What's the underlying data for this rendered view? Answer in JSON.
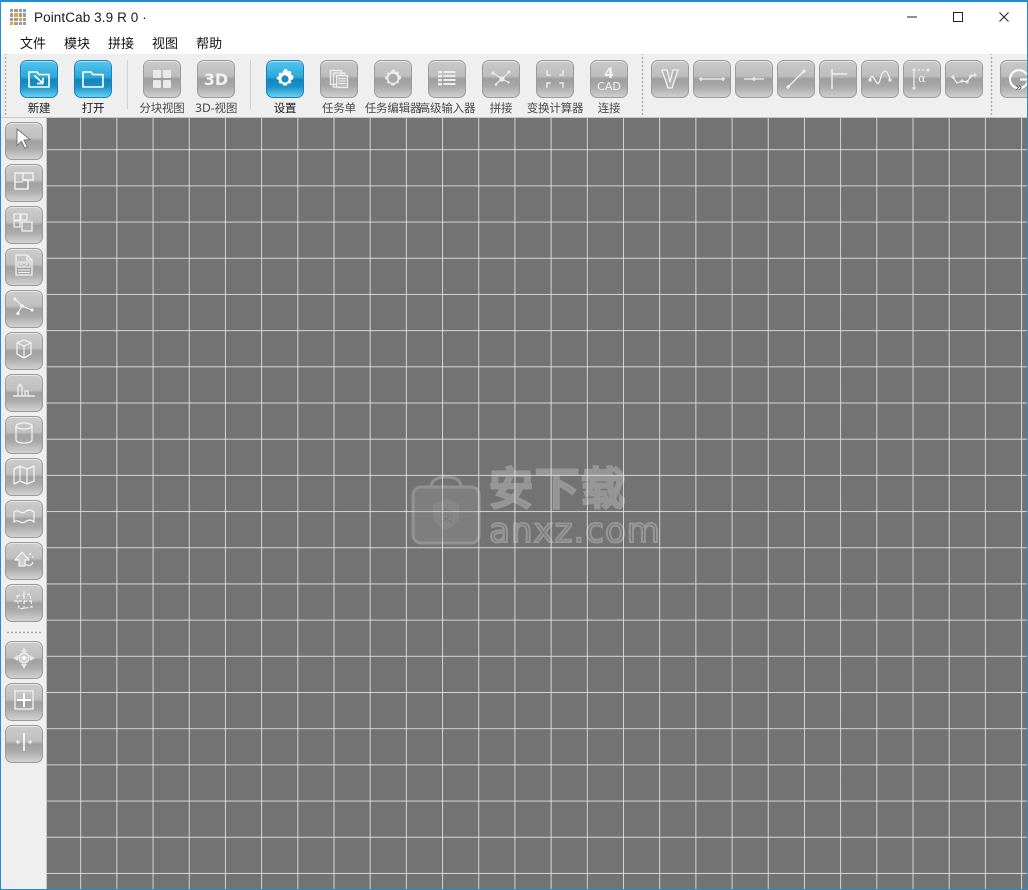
{
  "window": {
    "title": "PointCab 3.9 R 0 ·",
    "app_icon": "dotmatrix-logo-icon",
    "controls": [
      {
        "name": "minimize-button",
        "icon": "minimize-icon"
      },
      {
        "name": "maximize-button",
        "icon": "maximize-icon"
      },
      {
        "name": "close-button",
        "icon": "close-icon"
      }
    ],
    "accent_color": "#1e90d2"
  },
  "menubar": {
    "items": [
      {
        "label": "文件"
      },
      {
        "label": "模块"
      },
      {
        "label": "拼接"
      },
      {
        "label": "视图"
      },
      {
        "label": "帮助"
      }
    ]
  },
  "toolbar": {
    "overflow_label": "»",
    "groups": [
      {
        "name": "file-group",
        "buttons": [
          {
            "label": "新建",
            "icon": "new-project-icon",
            "active": true
          },
          {
            "label": "打开",
            "icon": "open-folder-icon",
            "active": true
          }
        ]
      },
      {
        "name": "view-group",
        "buttons": [
          {
            "label": "分块视图",
            "icon": "tiled-view-icon",
            "active": false
          },
          {
            "label": "3D-视图",
            "icon": "3d-view-icon",
            "active": false
          }
        ]
      },
      {
        "name": "job-group",
        "buttons": [
          {
            "label": "设置",
            "icon": "settings-gear-icon",
            "active": true
          },
          {
            "label": "任务单",
            "icon": "job-list-icon",
            "active": false
          },
          {
            "label": "任务编辑器",
            "icon": "job-editor-icon",
            "active": false
          },
          {
            "label": "高级输入器",
            "icon": "advanced-input-icon",
            "active": false
          },
          {
            "label": "拼接",
            "icon": "registration-icon",
            "active": false
          },
          {
            "label": "变换计算器",
            "icon": "transform-calc-icon",
            "active": false
          },
          {
            "label": "连接",
            "icon": "cad-connect-icon",
            "active": false
          }
        ]
      },
      {
        "name": "measure-group",
        "buttons": [
          {
            "label": "",
            "icon": "volume-v-icon",
            "active": false
          },
          {
            "label": "",
            "icon": "distance-icon",
            "active": false
          },
          {
            "label": "",
            "icon": "point-distance-icon",
            "active": false
          },
          {
            "label": "",
            "icon": "diagonal-line-icon",
            "active": false
          },
          {
            "label": "",
            "icon": "perpendicular-icon",
            "active": false
          },
          {
            "label": "",
            "icon": "curve-spline-icon",
            "active": false
          },
          {
            "label": "",
            "icon": "angle-alpha-icon",
            "active": false
          },
          {
            "label": "",
            "icon": "polyline-icon",
            "active": false
          }
        ]
      },
      {
        "name": "refresh-group",
        "buttons": [
          {
            "label": "",
            "icon": "refresh-rotate-icon",
            "active": false
          }
        ]
      }
    ]
  },
  "sidebar": {
    "groups": [
      {
        "name": "tools-group-main",
        "items": [
          {
            "icon": "cursor-arrow-icon",
            "name": "sidebar-item-select"
          },
          {
            "icon": "layout-plan-icon",
            "name": "sidebar-item-layout"
          },
          {
            "icon": "tiles-icon",
            "name": "sidebar-item-tiles"
          },
          {
            "icon": "pdf-document-icon",
            "name": "sidebar-item-pdf"
          },
          {
            "icon": "polygon-nodes-icon",
            "name": "sidebar-item-polygon"
          },
          {
            "icon": "cylinder-prism-icon",
            "name": "sidebar-item-volume"
          },
          {
            "icon": "terrain-profile-icon",
            "name": "sidebar-item-profile"
          },
          {
            "icon": "cylinder-icon",
            "name": "sidebar-item-cylinder"
          },
          {
            "icon": "folded-map-icon",
            "name": "sidebar-item-unfold"
          },
          {
            "icon": "wave-surface-icon",
            "name": "sidebar-item-surface"
          },
          {
            "icon": "cutout-arrow-icon",
            "name": "sidebar-item-cutout"
          },
          {
            "icon": "crop-region-icon",
            "name": "sidebar-item-crop"
          }
        ]
      },
      {
        "name": "tools-group-secondary",
        "items": [
          {
            "icon": "target-point-icon",
            "name": "sidebar-item-target"
          },
          {
            "icon": "crosshair-frame-icon",
            "name": "sidebar-item-crosshair"
          },
          {
            "icon": "split-axis-icon",
            "name": "sidebar-item-split"
          }
        ]
      }
    ]
  },
  "canvas": {
    "background_color": "#737373",
    "grid_color": "#e6e6e6",
    "grid_spacing_px": 36,
    "watermark": {
      "icon": "shield-bag-icon",
      "text_cn": "安下载",
      "text_en": "anxz.com"
    }
  }
}
